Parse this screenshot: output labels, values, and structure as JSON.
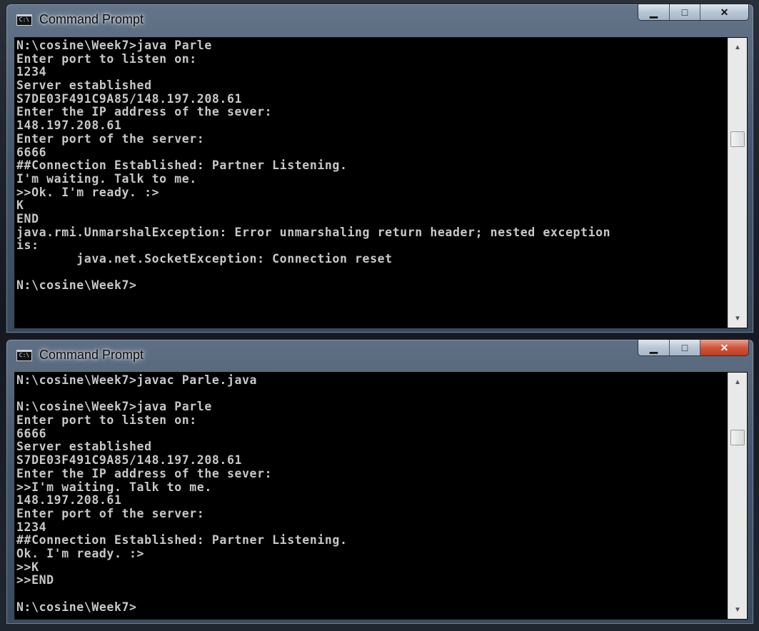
{
  "windows": [
    {
      "title": "Command Prompt",
      "icon": "C:\\",
      "buttons": {
        "minimize": "▁",
        "maximize": "□",
        "close": "✕"
      },
      "lines": [
        "N:\\cosine\\Week7>java Parle",
        "Enter port to listen on:",
        "1234",
        "Server established",
        "S7DE03F491C9A85/148.197.208.61",
        "Enter the IP address of the sever:",
        "148.197.208.61",
        "Enter port of the server:",
        "6666",
        "##Connection Established: Partner Listening.",
        "I'm waiting. Talk to me.",
        ">>Ok. I'm ready. :>",
        "K",
        "END",
        "java.rmi.UnmarshalException: Error unmarshaling return header; nested exception",
        "is:",
        "        java.net.SocketException: Connection reset",
        "",
        "N:\\cosine\\Week7>"
      ]
    },
    {
      "title": "Command Prompt",
      "icon": "C:\\",
      "buttons": {
        "minimize": "▁",
        "maximize": "□",
        "close": "✕"
      },
      "lines": [
        "N:\\cosine\\Week7>javac Parle.java",
        "",
        "N:\\cosine\\Week7>java Parle",
        "Enter port to listen on:",
        "6666",
        "Server established",
        "S7DE03F491C9A85/148.197.208.61",
        "Enter the IP address of the sever:",
        ">>I'm waiting. Talk to me.",
        "148.197.208.61",
        "Enter port of the server:",
        "1234",
        "##Connection Established: Partner Listening.",
        "Ok. I'm ready. :>",
        ">>K",
        ">>END",
        "",
        "N:\\cosine\\Week7>"
      ]
    }
  ],
  "colors": {
    "console_bg": "#000000",
    "console_text": "#c8c8c8",
    "close_active": "#c03b22"
  }
}
